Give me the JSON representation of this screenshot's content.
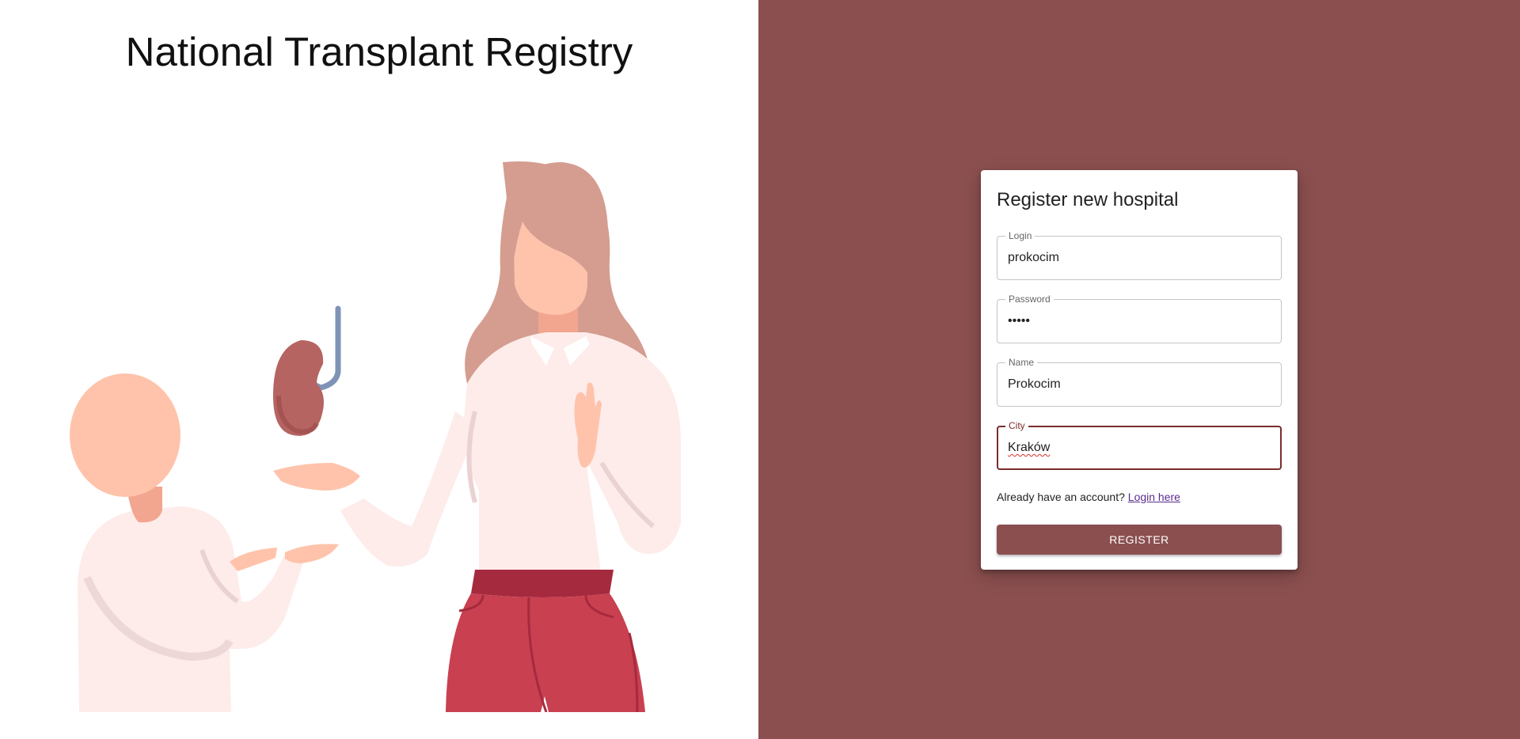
{
  "app": {
    "title": "National Transplant Registry"
  },
  "colors": {
    "accent": "#8b4f4f",
    "focus_border": "#7b2d2d",
    "link": "#5b2c8f"
  },
  "illustration": {
    "icon": "kidney-donation-illustration"
  },
  "form": {
    "title": "Register new hospital",
    "fields": {
      "login": {
        "label": "Login",
        "value": "prokocim"
      },
      "password": {
        "label": "Password",
        "value": "•••••"
      },
      "name": {
        "label": "Name",
        "value": "Prokocim"
      },
      "city": {
        "label": "City",
        "value": "Kraków",
        "focused": true
      }
    },
    "account_prompt": "Already have an account?",
    "login_link": "Login here",
    "submit_label": "REGISTER"
  }
}
